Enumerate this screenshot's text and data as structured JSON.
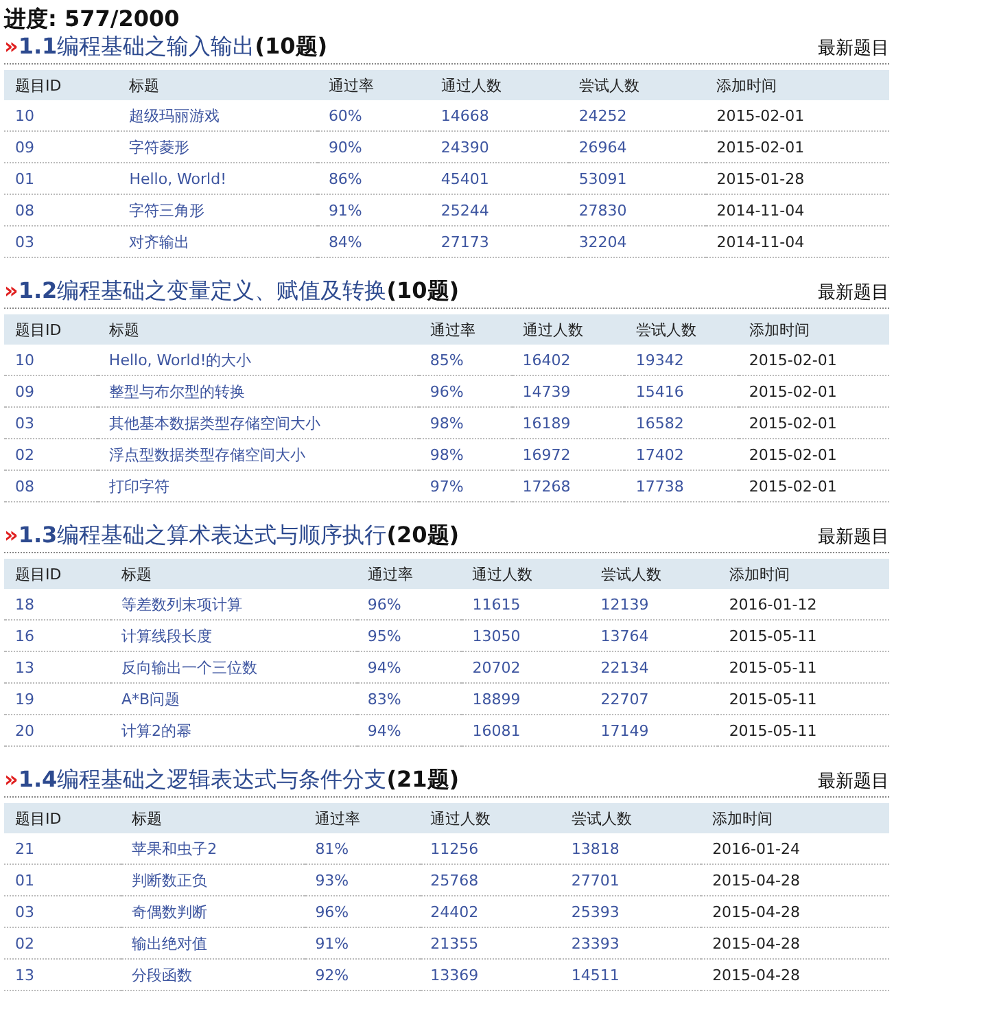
{
  "progress": "进度: 577/2000",
  "sections": [
    {
      "marker": "»",
      "number": "1.1",
      "name": "编程基础之输入输出",
      "count": "(10题)",
      "link": "最新题目",
      "columns": [
        "题目ID",
        "标题",
        "通过率",
        "通过人数",
        "尝试人数",
        "添加时间"
      ],
      "rows": [
        [
          "10",
          "超级玛丽游戏",
          "60%",
          "14668",
          "24252",
          "2015-02-01"
        ],
        [
          "09",
          "字符菱形",
          "90%",
          "24390",
          "26964",
          "2015-02-01"
        ],
        [
          "01",
          "Hello, World!",
          "86%",
          "45401",
          "53091",
          "2015-01-28"
        ],
        [
          "08",
          "字符三角形",
          "91%",
          "25244",
          "27830",
          "2014-11-04"
        ],
        [
          "03",
          "对齐输出",
          "84%",
          "27173",
          "32204",
          "2014-11-04"
        ]
      ]
    },
    {
      "marker": "»",
      "number": "1.2",
      "name": "编程基础之变量定义、赋值及转换",
      "count": "(10题)",
      "link": "最新题目",
      "columns": [
        "题目ID",
        "标题",
        "通过率",
        "通过人数",
        "尝试人数",
        "添加时间"
      ],
      "rows": [
        [
          "10",
          "Hello, World!的大小",
          "85%",
          "16402",
          "19342",
          "2015-02-01"
        ],
        [
          "09",
          "整型与布尔型的转换",
          "96%",
          "14739",
          "15416",
          "2015-02-01"
        ],
        [
          "03",
          "其他基本数据类型存储空间大小",
          "98%",
          "16189",
          "16582",
          "2015-02-01"
        ],
        [
          "02",
          "浮点型数据类型存储空间大小",
          "98%",
          "16972",
          "17402",
          "2015-02-01"
        ],
        [
          "08",
          "打印字符",
          "97%",
          "17268",
          "17738",
          "2015-02-01"
        ]
      ]
    },
    {
      "marker": "»",
      "number": "1.3",
      "name": "编程基础之算术表达式与顺序执行",
      "count": "(20题)",
      "link": "最新题目",
      "columns": [
        "题目ID",
        "标题",
        "通过率",
        "通过人数",
        "尝试人数",
        "添加时间"
      ],
      "rows": [
        [
          "18",
          "等差数列末项计算",
          "96%",
          "11615",
          "12139",
          "2016-01-12"
        ],
        [
          "16",
          "计算线段长度",
          "95%",
          "13050",
          "13764",
          "2015-05-11"
        ],
        [
          "13",
          "反向输出一个三位数",
          "94%",
          "20702",
          "22134",
          "2015-05-11"
        ],
        [
          "19",
          "A*B问题",
          "83%",
          "18899",
          "22707",
          "2015-05-11"
        ],
        [
          "20",
          "计算2的幂",
          "94%",
          "16081",
          "17149",
          "2015-05-11"
        ]
      ]
    },
    {
      "marker": "»",
      "number": "1.4",
      "name": "编程基础之逻辑表达式与条件分支",
      "count": "(21题)",
      "link": "最新题目",
      "columns": [
        "题目ID",
        "标题",
        "通过率",
        "通过人数",
        "尝试人数",
        "添加时间"
      ],
      "rows": [
        [
          "21",
          "苹果和虫子2",
          "81%",
          "11256",
          "13818",
          "2016-01-24"
        ],
        [
          "01",
          "判断数正负",
          "93%",
          "25768",
          "27701",
          "2015-04-28"
        ],
        [
          "03",
          "奇偶数判断",
          "96%",
          "24402",
          "25393",
          "2015-04-28"
        ],
        [
          "02",
          "输出绝对值",
          "91%",
          "21355",
          "23393",
          "2015-04-28"
        ],
        [
          "13",
          "分段函数",
          "92%",
          "13369",
          "14511",
          "2015-04-28"
        ]
      ]
    }
  ]
}
